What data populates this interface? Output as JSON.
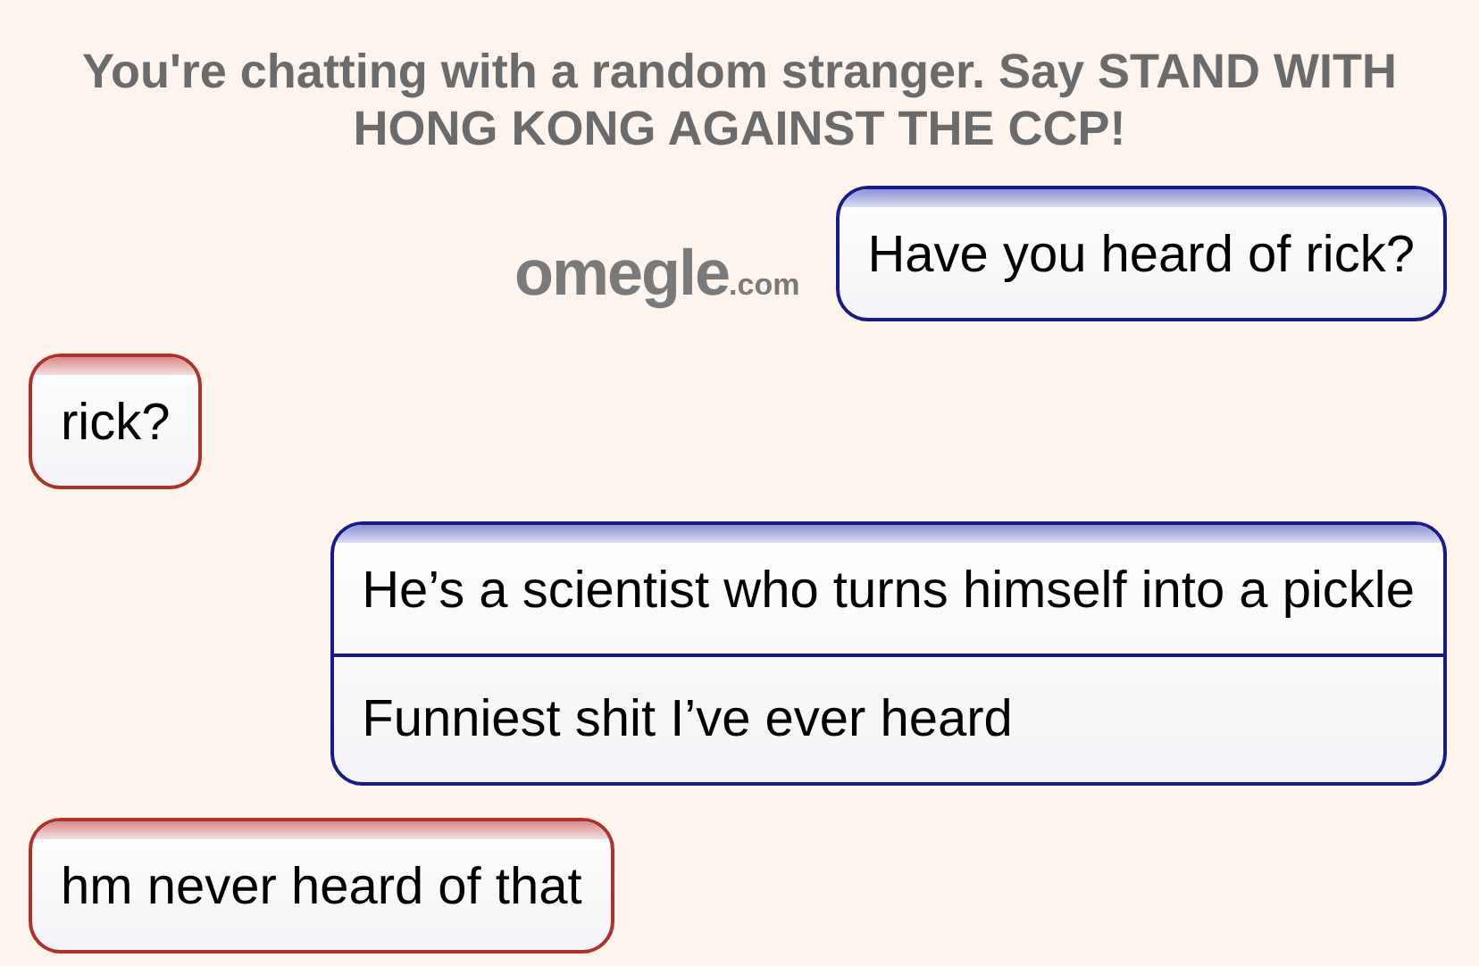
{
  "header": "You're chatting with a random stranger. Say STAND WITH HONG KONG AGAINST THE CCP!",
  "logo": {
    "name": "omegle",
    "suffix": ".com"
  },
  "messages": [
    {
      "kind": "me",
      "lines": [
        "Have you heard of rick?"
      ]
    },
    {
      "kind": "stranger",
      "lines": [
        "rick?"
      ]
    },
    {
      "kind": "me",
      "lines": [
        "He’s a scientist who turns himself into a pickle",
        "Funniest shit I’ve ever heard"
      ]
    },
    {
      "kind": "stranger",
      "lines": [
        "hm never heard of that"
      ]
    }
  ]
}
